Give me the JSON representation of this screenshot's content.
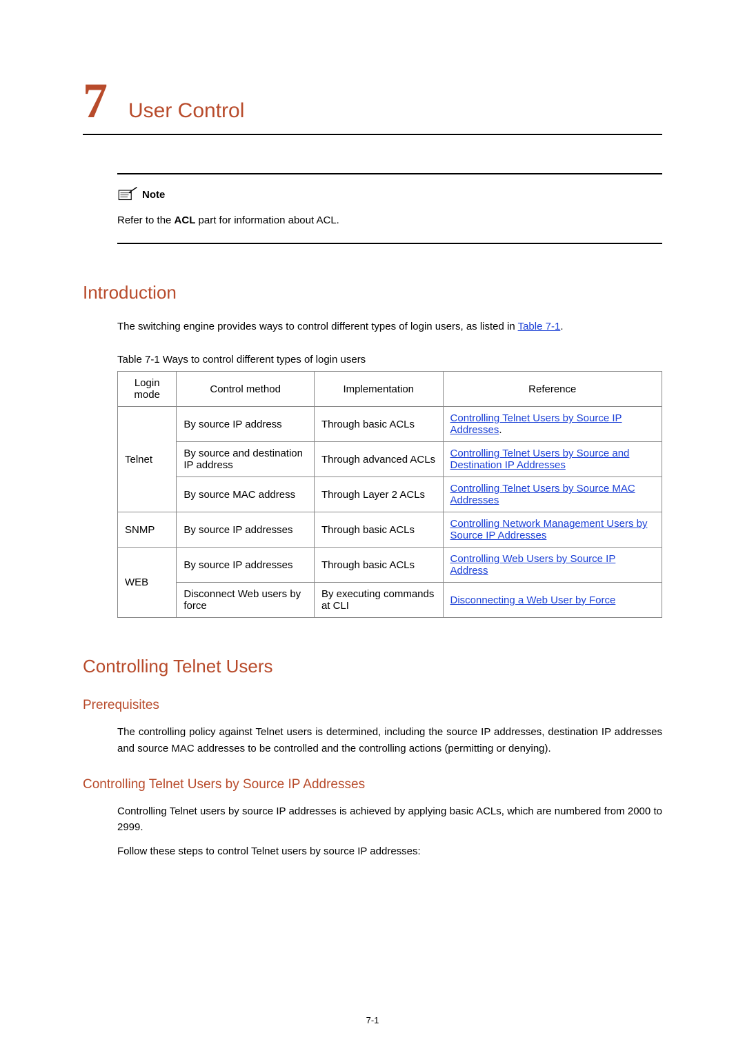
{
  "chapter": {
    "number": "7",
    "title": "User Control"
  },
  "note": {
    "label": "Note",
    "before_bold": "Refer to the ",
    "bold": "ACL",
    "after_bold": " part for information about ACL."
  },
  "intro": {
    "heading": "Introduction",
    "para_before_link": "The switching engine provides ways to control different types of login users, as listed in ",
    "link": "Table 7-1",
    "para_after_link": ".",
    "table_caption": "Table 7-1  Ways to control different types of login users"
  },
  "table": {
    "headers": [
      "Login mode",
      "Control method",
      "Implementation",
      "Reference"
    ],
    "groups": [
      {
        "mode": "Telnet",
        "rows": [
          {
            "method": "By source IP address",
            "impl": "Through basic ACLs",
            "ref": "Controlling Telnet Users by Source IP Addresses",
            "ref_suffix": "."
          },
          {
            "method": "By source and destination IP address",
            "impl": "Through advanced ACLs",
            "ref": "Controlling Telnet Users by Source and Destination IP Addresses",
            "ref_suffix": ""
          },
          {
            "method": "By source MAC address",
            "impl": "Through Layer 2 ACLs",
            "ref": "Controlling Telnet Users by Source MAC Addresses",
            "ref_suffix": ""
          }
        ]
      },
      {
        "mode": "SNMP",
        "rows": [
          {
            "method": "By source IP addresses",
            "impl": "Through basic ACLs",
            "ref": "Controlling Network Management Users by Source IP Addresses",
            "ref_suffix": ""
          }
        ]
      },
      {
        "mode": "WEB",
        "rows": [
          {
            "method": "By source IP addresses",
            "impl": "Through basic ACLs",
            "ref": "Controlling Web Users by Source IP Address",
            "ref_suffix": ""
          },
          {
            "method": "Disconnect Web users by force",
            "impl": "By executing commands at CLI",
            "ref": "Disconnecting a Web User by Force",
            "ref_suffix": ""
          }
        ]
      }
    ]
  },
  "section2": {
    "heading": "Controlling Telnet Users",
    "sub1": {
      "heading": "Prerequisites",
      "para": "The controlling policy against Telnet users is determined, including the source IP addresses, destination IP addresses and source MAC addresses to be controlled and the controlling actions (permitting or denying)."
    },
    "sub2": {
      "heading": "Controlling Telnet Users by Source IP Addresses",
      "para1": "Controlling Telnet users by source IP addresses is achieved by applying basic ACLs, which are numbered from 2000 to 2999.",
      "para2": "Follow these steps to control Telnet users by source IP addresses:"
    }
  },
  "page_number": "7-1"
}
